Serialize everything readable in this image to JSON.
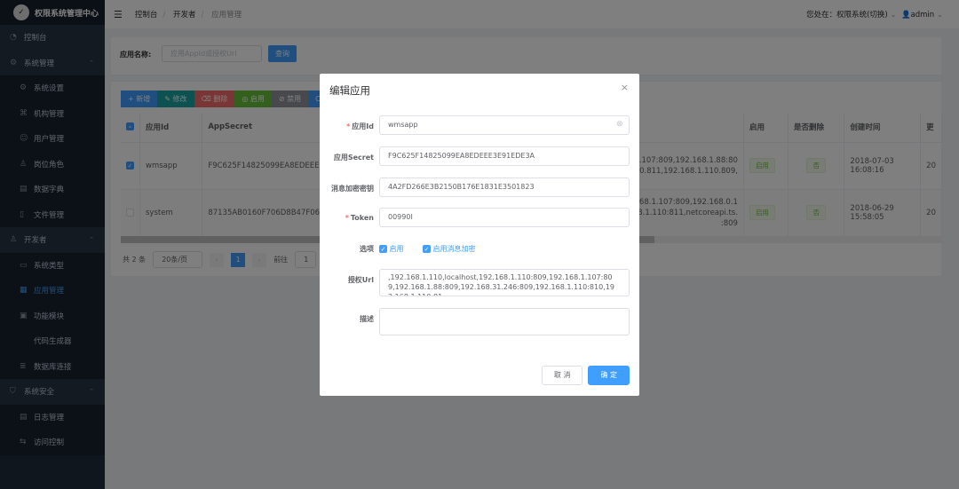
{
  "app": {
    "title": "权限系统管理中心"
  },
  "sidebar": {
    "items": [
      {
        "label": "控制台",
        "icon": "dashboard-icon",
        "type": "g"
      },
      {
        "label": "系统管理",
        "icon": "gear-icon",
        "type": "g",
        "arrow": true
      },
      {
        "label": "系统设置",
        "icon": "gear-icon",
        "type": "s"
      },
      {
        "label": "机构管理",
        "icon": "org-tree-icon",
        "type": "s"
      },
      {
        "label": "用户管理",
        "icon": "user-icon",
        "type": "s"
      },
      {
        "label": "岗位角色",
        "icon": "role-icon",
        "type": "s"
      },
      {
        "label": "数据字典",
        "icon": "dictionary-icon",
        "type": "s"
      },
      {
        "label": "文件管理",
        "icon": "file-icon",
        "type": "s"
      },
      {
        "label": "开发者",
        "icon": "developer-icon",
        "type": "g",
        "arrow": true
      },
      {
        "label": "系统类型",
        "icon": "window-icon",
        "type": "s"
      },
      {
        "label": "应用管理",
        "icon": "grid-icon",
        "type": "s",
        "active": true
      },
      {
        "label": "功能模块",
        "icon": "modules-icon",
        "type": "s"
      },
      {
        "label": "代码生成器",
        "icon": "code-icon",
        "type": "s"
      },
      {
        "label": "数据库连接",
        "icon": "database-icon",
        "type": "s"
      },
      {
        "label": "系统安全",
        "icon": "shield-icon",
        "type": "g",
        "arrow": true
      },
      {
        "label": "日志管理",
        "icon": "log-icon",
        "type": "s"
      },
      {
        "label": "访问控制",
        "icon": "access-icon",
        "type": "s"
      }
    ]
  },
  "header": {
    "breadcrumb": [
      "控制台",
      "开发者",
      "应用管理"
    ],
    "location": "您处在：权限系统(切换)",
    "user": "admin"
  },
  "search": {
    "label": "应用名称:",
    "placeholder": "应用AppId或授权Url",
    "button": "查询"
  },
  "toolbar": [
    {
      "label": "+ 新增",
      "color": "#409eff"
    },
    {
      "label": "✎ 修改",
      "color": "#1aa3a3"
    },
    {
      "label": "⌫ 删除",
      "color": "#f56c6c"
    },
    {
      "label": "◎ 启用",
      "color": "#67c23a"
    },
    {
      "label": "⊘ 禁用",
      "color": "#909399"
    },
    {
      "label": "C",
      "color": "#409eff"
    }
  ],
  "table": {
    "headers": [
      "应用Id",
      "AppSecret",
      "启用",
      "是否删除",
      "创建时间",
      "更"
    ],
    "rows": [
      {
        "checked": true,
        "id": "wmsapp",
        "secret": "F9C625F14825099EA8EDEEE3E91",
        "url1": ".168.1.107:809,192.168.1.88:80",
        "url2": "68.1.110.811,192.168.1.110.809,",
        "url3": "",
        "enabled": "启用",
        "deleted": "否",
        "created": "2018-07-03 16:08:16",
        "upd": "20"
      },
      {
        "checked": false,
        "id": "system",
        "secret": "87135AB0160F706D8B47F06BDAB",
        "url1": ",192.168.1.107:809,192.168.0.1",
        "url2": "192.168.1.110:811,netcoreapi.ts.",
        "url3": ":809",
        "enabled": "启用",
        "deleted": "否",
        "created": "2018-06-29 15:58:05",
        "upd": "20"
      }
    ]
  },
  "pagination": {
    "total": "共 2 条",
    "page_size": "20条/页",
    "current": "1",
    "goto_label": "前往",
    "goto_value": "1"
  },
  "modal": {
    "title": "编辑应用",
    "fields": {
      "app_id": {
        "label": "应用Id",
        "value": "wmsapp"
      },
      "secret": {
        "label": "应用Secret",
        "value": "F9C625F14825099EA8EDEEE3E91EDE3A"
      },
      "enc_key": {
        "label": "消息加密密钥",
        "value": "4A2FD266E3B2150B176E1831E3501823"
      },
      "token": {
        "label": "Token",
        "value": "00990I"
      },
      "options": {
        "label": "选项",
        "enable": "启用",
        "encrypt": "启用消息加密"
      },
      "auth_url": {
        "label": "授权Url",
        "value": ",192.168.1.110,localhost,192.168.1.110:809,192.168.1.107:809,192.168.1.88:809,192.168.31.246:809,192.168.1.110:810,192.168.1.110:81"
      },
      "desc": {
        "label": "描述",
        "value": ""
      }
    },
    "cancel": "取 消",
    "confirm": "确 定"
  }
}
